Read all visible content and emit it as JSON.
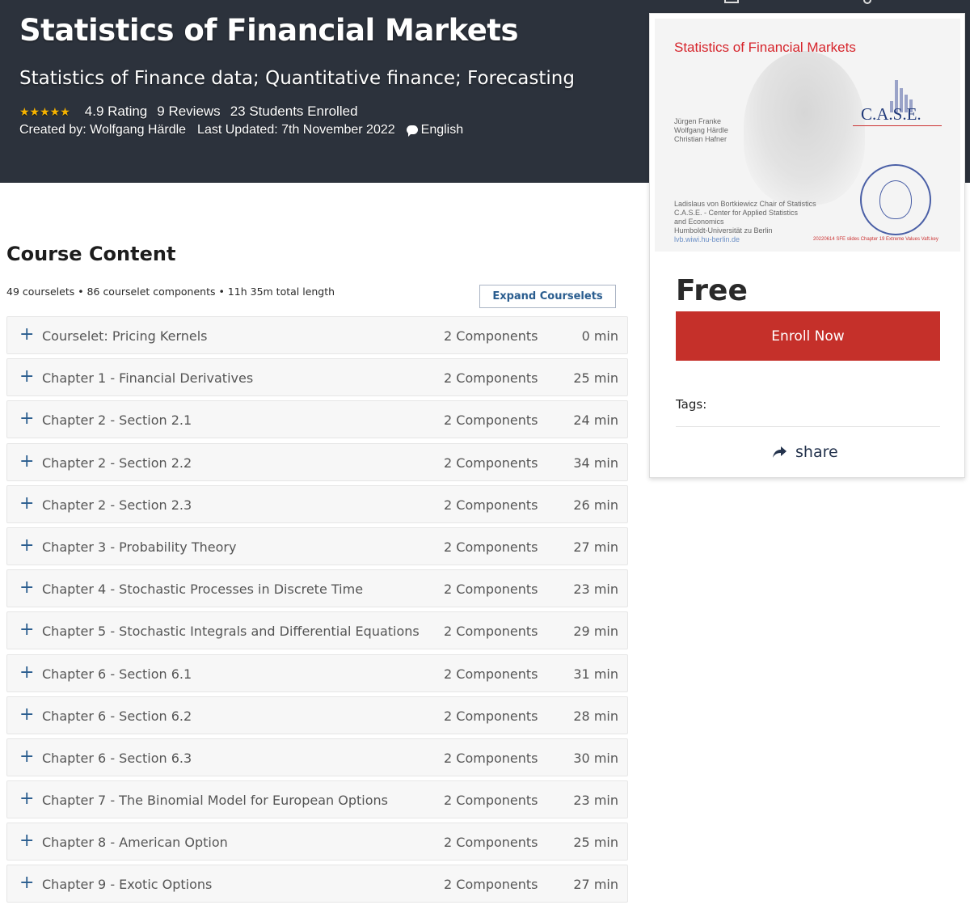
{
  "hero": {
    "title": "Statistics of Financial Markets",
    "subtitle": "Statistics of Finance data; Quantitative finance; Forecasting",
    "rating_label": "4.9 Rating",
    "reviews_label": "9 Reviews",
    "students_label": "23 Students Enrolled",
    "rating_stars": 5,
    "created_by": "Created by: Wolfgang Härdle",
    "last_updated": "Last Updated: 7th November 2022",
    "language": "English"
  },
  "card": {
    "thumbnail": {
      "title": "Statistics of Financial Markets",
      "authors": [
        "Jürgen Franke",
        "Wolfgang Härdle",
        "Christian Hafner"
      ],
      "chair_lines": [
        "Ladislaus von Bortkiewicz Chair of Statistics",
        "C.A.S.E. - Center for Applied Statistics",
        "and Economics",
        "Humboldt-Universität zu Berlin"
      ],
      "link": "lvb.wiwi.hu-berlin.de",
      "logo_text": "C.A.S.E.",
      "footer": "20220614 SFE slides Chapter 19 Extreme Values Vaft.key"
    },
    "price": "Free",
    "enroll_label": "Enroll Now",
    "tags_label": "Tags:",
    "share_label": "share"
  },
  "content": {
    "title": "Course Content",
    "summary": "49 courselets • 86 courselet components • 11h 35m total length",
    "expand_label": "Expand Courselets",
    "rows": [
      {
        "name": "Courselet: Pricing Kernels",
        "components": "2 Components",
        "duration": "0 min"
      },
      {
        "name": "Chapter 1 - Financial Derivatives",
        "components": "2 Components",
        "duration": "25 min"
      },
      {
        "name": "Chapter 2 - Section 2.1",
        "components": "2 Components",
        "duration": "24 min"
      },
      {
        "name": "Chapter 2 - Section 2.2",
        "components": "2 Components",
        "duration": "34 min"
      },
      {
        "name": "Chapter 2 - Section 2.3",
        "components": "2 Components",
        "duration": "26 min"
      },
      {
        "name": "Chapter 3 - Probability Theory",
        "components": "2 Components",
        "duration": "27 min"
      },
      {
        "name": "Chapter 4 - Stochastic Processes in Discrete Time",
        "components": "2 Components",
        "duration": "23 min"
      },
      {
        "name": "Chapter 5 - Stochastic Integrals and Differential Equations",
        "components": "2 Components",
        "duration": "29 min"
      },
      {
        "name": "Chapter 6 - Section 6.1",
        "components": "2 Components",
        "duration": "31 min"
      },
      {
        "name": "Chapter 6 - Section 6.2",
        "components": "2 Components",
        "duration": "28 min"
      },
      {
        "name": "Chapter 6 - Section 6.3",
        "components": "2 Components",
        "duration": "30 min"
      },
      {
        "name": "Chapter 7 - The Binomial Model for European Options",
        "components": "2 Components",
        "duration": "23 min"
      },
      {
        "name": "Chapter 8 - American Option",
        "components": "2 Components",
        "duration": "25 min"
      },
      {
        "name": "Chapter 9 - Exotic Options",
        "components": "2 Components",
        "duration": "27 min"
      }
    ]
  },
  "colors": {
    "hero_bg": "#2c323c",
    "enroll_bg": "#c5302a",
    "accent_blue": "#2a5d8f",
    "star": "#f5b301"
  },
  "icons": {
    "expand_row": "plus-icon",
    "language": "chat-bubble-icon",
    "share": "share-arrow-icon"
  }
}
